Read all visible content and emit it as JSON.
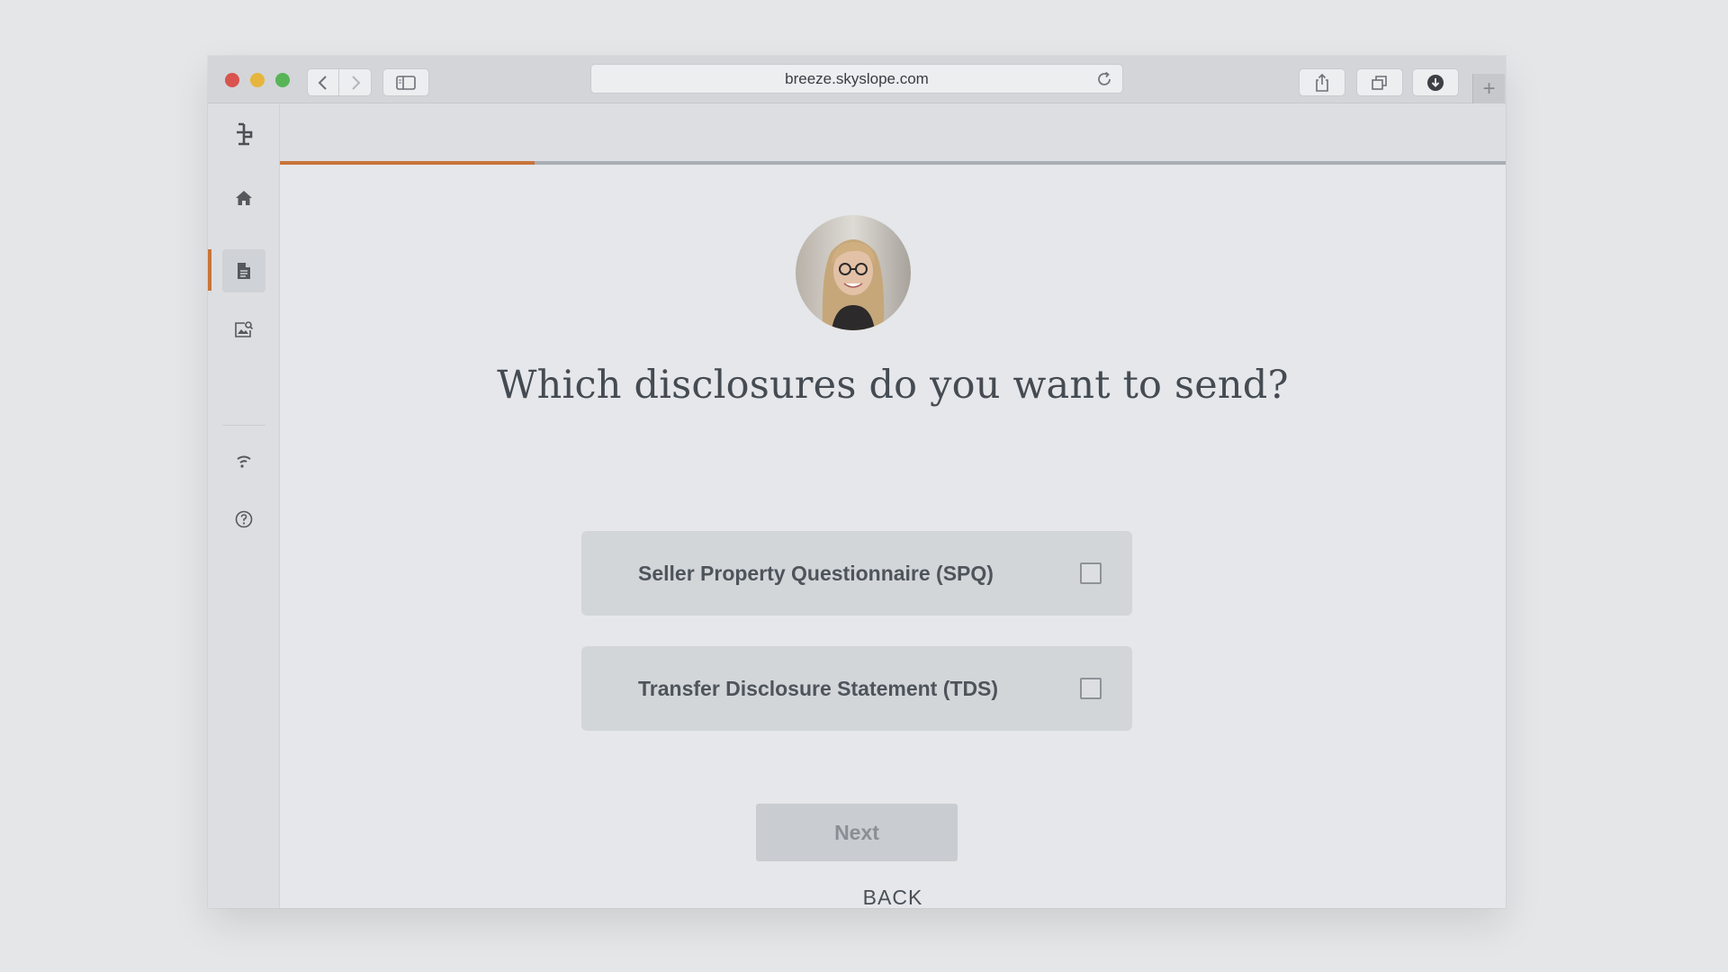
{
  "browser": {
    "url": "breeze.skyslope.com",
    "icons": {
      "back": "chevron-left-icon",
      "forward": "chevron-right-icon",
      "sidebar": "sidebar-icon",
      "reload": "reload-icon",
      "share": "share-icon",
      "tabs": "tabs-icon",
      "download": "download-icon",
      "new_tab": "plus-icon"
    },
    "new_tab_label": "+"
  },
  "sidebar": {
    "items": [
      {
        "name": "home",
        "icon": "home-icon"
      },
      {
        "name": "documents",
        "icon": "document-icon",
        "active": true
      },
      {
        "name": "contacts",
        "icon": "image-search-icon"
      },
      {
        "name": "signal",
        "icon": "signal-icon"
      },
      {
        "name": "help",
        "icon": "help-circle-icon"
      }
    ],
    "accent_color": "#c9743a"
  },
  "progress": {
    "fraction": 0.208,
    "fill_color": "#c9743a",
    "track_color": "#a9aeb4"
  },
  "avatar": {
    "icon": "agent-avatar"
  },
  "main": {
    "question": "Which disclosures do you want to send?",
    "options": [
      {
        "label": "Seller Property Questionnaire (SPQ)",
        "checked": false
      },
      {
        "label": "Transfer Disclosure Statement (TDS)",
        "checked": false
      }
    ],
    "next_label": "Next",
    "back_label": "BACK"
  }
}
